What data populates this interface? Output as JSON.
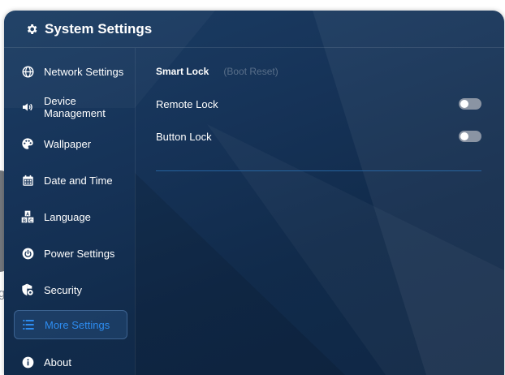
{
  "window": {
    "title": "System Settings"
  },
  "sidebar": {
    "items": [
      {
        "label": "Network Settings",
        "icon": "globe-icon"
      },
      {
        "label": "Device Management",
        "label_line1": "Device",
        "label_line2": "Management",
        "icon": "speaker-icon"
      },
      {
        "label": "Wallpaper",
        "icon": "palette-icon"
      },
      {
        "label": "Date and Time",
        "icon": "calendar-icon"
      },
      {
        "label": "Language",
        "icon": "language-icon"
      },
      {
        "label": "Power Settings",
        "icon": "power-icon"
      },
      {
        "label": "Security",
        "icon": "shield-gear-icon"
      },
      {
        "label": "More Settings",
        "icon": "list-icon",
        "active": true
      },
      {
        "label": "About",
        "icon": "info-icon"
      }
    ]
  },
  "content": {
    "tabs": [
      {
        "label": "Smart Lock",
        "active": true
      },
      {
        "label": "(Boot Reset)",
        "active": false
      }
    ],
    "settings": [
      {
        "label": "Remote Lock",
        "enabled": false
      },
      {
        "label": "Button Lock",
        "enabled": false
      }
    ]
  },
  "background_fragment": {
    "text": "ge"
  },
  "colors": {
    "accent": "#2d8cf0",
    "panel_bg": "#163358",
    "toggle_off": "#8a94a3",
    "divider": "#2a6fb0"
  }
}
